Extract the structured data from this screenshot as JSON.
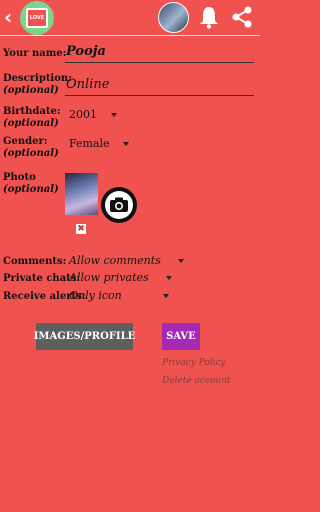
{
  "header": {
    "back_icon": "chevron-left-icon",
    "logo_text": "LOVE",
    "avatar_icon": "profile-avatar",
    "notification_icon": "bell-icon",
    "share_icon": "share-icon"
  },
  "form": {
    "name_label": "Your name:",
    "name_value": "Pooja",
    "description_label": "Description:",
    "description_optional": "(optional)",
    "description_value": "Online",
    "birthdate_label": "Birthdate:",
    "birthdate_optional": "(optional)",
    "birthdate_value": "2001",
    "gender_label": "Gender:",
    "gender_optional": "(optional)",
    "gender_value": "Female",
    "photo_label": "Photo",
    "photo_optional": "(optional)",
    "delete_photo_glyph": "✖",
    "comments_label": "Comments:",
    "comments_value": "Allow comments",
    "private_chats_label": "Private chats:",
    "private_chats_value": "Allow privates",
    "receive_alerts_label": "Receive alerts:",
    "receive_alerts_value": "Only icon"
  },
  "actions": {
    "images_profile_label": "IMAGES/PROFILE",
    "save_label": "SAVE",
    "privacy_policy_label": "Privacy Policy",
    "delete_account_label": "Delete account"
  },
  "colors": {
    "background": "#F0524F",
    "save_button": "#A42AB5",
    "images_button": "#5F5F5F",
    "logo_circle": "#7DD58D"
  }
}
